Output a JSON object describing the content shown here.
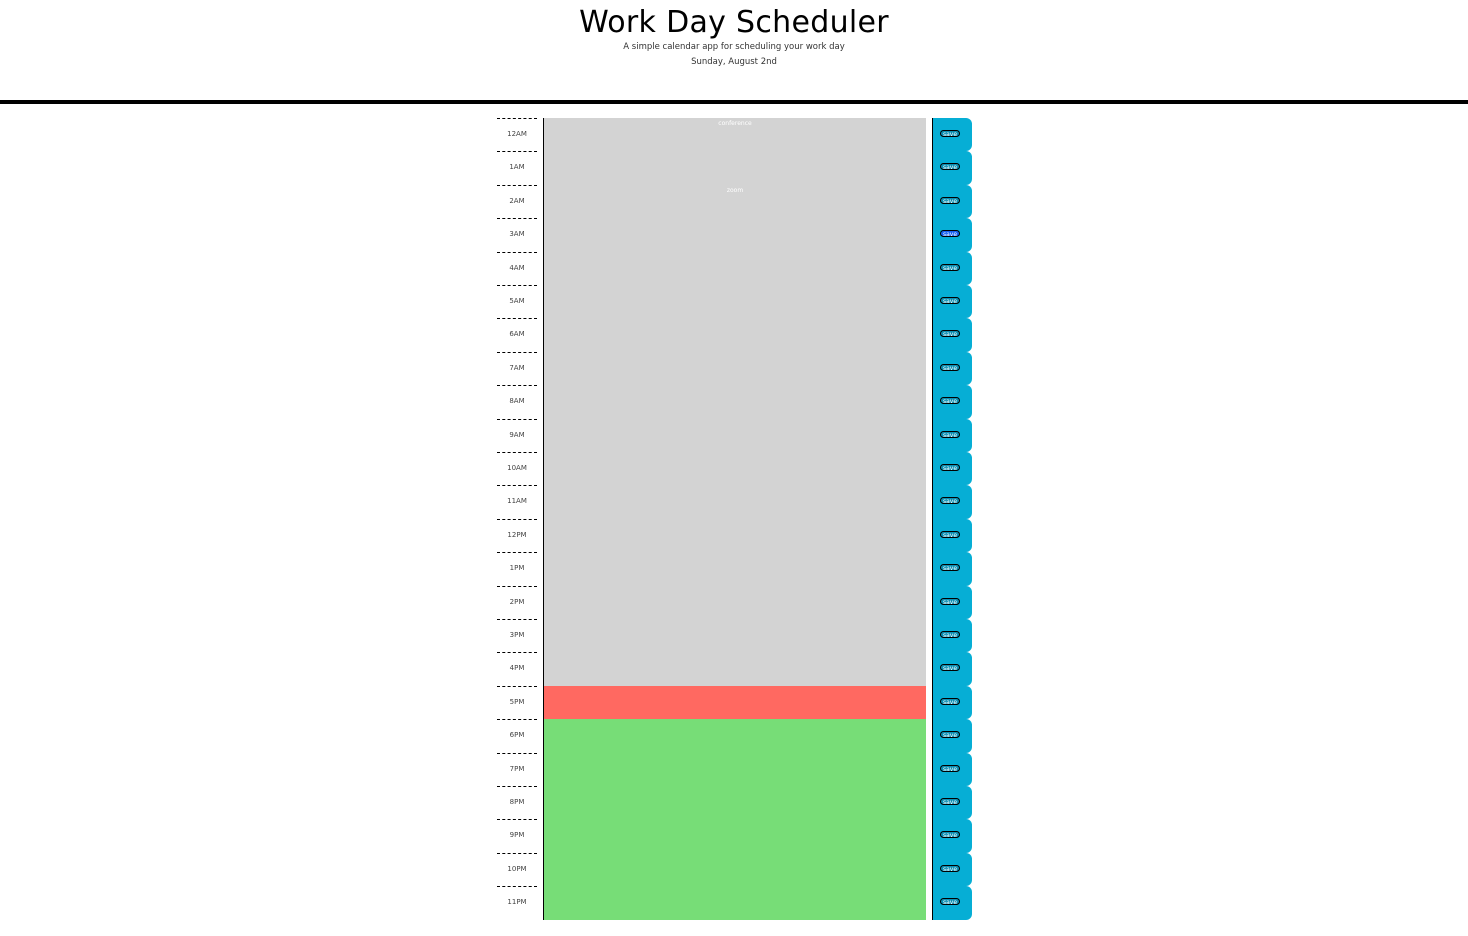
{
  "header": {
    "title": "Work Day Scheduler",
    "subtitle": "A simple calendar app for scheduling your work day",
    "current_day": "Sunday, August 2nd"
  },
  "colors": {
    "past": "#d3d3d3",
    "present": "#ff6961",
    "future": "#77dd77",
    "save": "#06aed5"
  },
  "save_label": "save",
  "rows": [
    {
      "hour": "12AM",
      "text": "conference",
      "status": "past"
    },
    {
      "hour": "1AM",
      "text": "",
      "status": "past"
    },
    {
      "hour": "2AM",
      "text": "zoom",
      "status": "past"
    },
    {
      "hour": "3AM",
      "text": "",
      "status": "past",
      "active": true
    },
    {
      "hour": "4AM",
      "text": "",
      "status": "past"
    },
    {
      "hour": "5AM",
      "text": "",
      "status": "past"
    },
    {
      "hour": "6AM",
      "text": "",
      "status": "past"
    },
    {
      "hour": "7AM",
      "text": "",
      "status": "past"
    },
    {
      "hour": "8AM",
      "text": "",
      "status": "past"
    },
    {
      "hour": "9AM",
      "text": "",
      "status": "past"
    },
    {
      "hour": "10AM",
      "text": "",
      "status": "past"
    },
    {
      "hour": "11AM",
      "text": "",
      "status": "past"
    },
    {
      "hour": "12PM",
      "text": "",
      "status": "past"
    },
    {
      "hour": "1PM",
      "text": "",
      "status": "past"
    },
    {
      "hour": "2PM",
      "text": "",
      "status": "past"
    },
    {
      "hour": "3PM",
      "text": "",
      "status": "past"
    },
    {
      "hour": "4PM",
      "text": "",
      "status": "past"
    },
    {
      "hour": "5PM",
      "text": "",
      "status": "present"
    },
    {
      "hour": "6PM",
      "text": "",
      "status": "future"
    },
    {
      "hour": "7PM",
      "text": "",
      "status": "future"
    },
    {
      "hour": "8PM",
      "text": "",
      "status": "future"
    },
    {
      "hour": "9PM",
      "text": "",
      "status": "future"
    },
    {
      "hour": "10PM",
      "text": "",
      "status": "future"
    },
    {
      "hour": "11PM",
      "text": "",
      "status": "future"
    }
  ]
}
